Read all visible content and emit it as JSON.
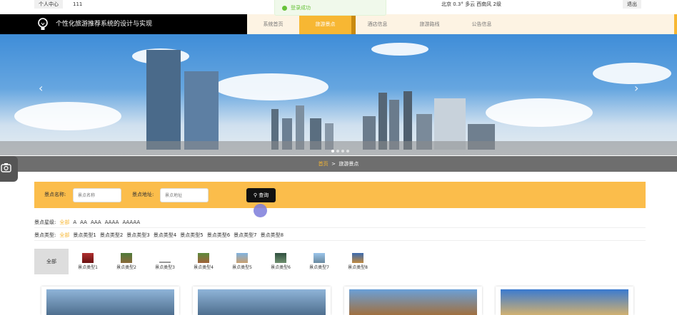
{
  "topbar": {
    "user_center": "个人中心",
    "username": "111",
    "weather": "北京  0.3°  多云  西南风  2级",
    "logout": "退出"
  },
  "toast": {
    "message": "登录成功"
  },
  "header": {
    "site_title": "个性化旅游推荐系统的设计与实现"
  },
  "nav": {
    "items": [
      {
        "label": "系统首页",
        "active": false
      },
      {
        "label": "旅游景点",
        "active": true
      },
      {
        "label": "酒店信息",
        "active": false
      },
      {
        "label": "旅游路线",
        "active": false
      },
      {
        "label": "公告信息",
        "active": false
      }
    ]
  },
  "banner": {
    "prev_icon": "chevron-left-icon",
    "next_icon": "chevron-right-icon",
    "slides": 4,
    "current_slide": 1
  },
  "breadcrumb": {
    "home": "首页",
    "sep": ">",
    "current": "旅游景点"
  },
  "search": {
    "name_label": "景点名称:",
    "name_placeholder": "景点名称",
    "addr_label": "景点地址:",
    "addr_placeholder": "景点地址",
    "button": "查询"
  },
  "filters": {
    "level": {
      "label": "景点星级:",
      "options": [
        "全部",
        "A",
        "AA",
        "AAA",
        "AAAA",
        "AAAAA"
      ]
    },
    "type": {
      "label": "景点类型:",
      "options": [
        "全部",
        "景点类型1",
        "景点类型2",
        "景点类型3",
        "景点类型4",
        "景点类型5",
        "景点类型6",
        "景点类型7",
        "景点类型8"
      ]
    }
  },
  "categories": {
    "all": "全部",
    "items": [
      "景点类型1",
      "景点类型2",
      "景点类型3",
      "景点类型4",
      "景点类型5",
      "景点类型6",
      "景点类型7",
      "景点类型8"
    ]
  },
  "colors": {
    "accent": "#f7b733",
    "search_bg": "#fbbd4b",
    "brand_bg": "#000000",
    "success": "#67c23a"
  }
}
